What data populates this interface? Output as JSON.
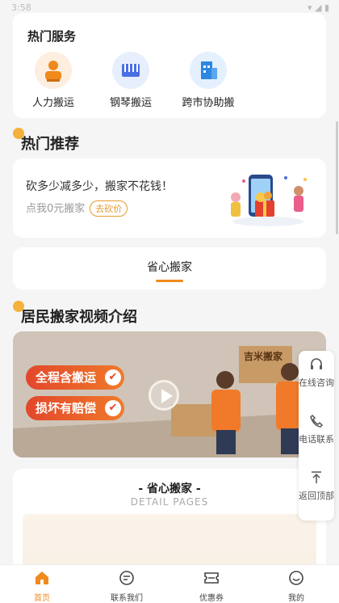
{
  "statusbar": {
    "time": "3:58",
    "icons": "▾ ◢ ▮"
  },
  "services": {
    "title": "热门服务",
    "items": [
      {
        "label": "人力搬运",
        "icon": "mover-person-icon",
        "bg": "#fdeee0",
        "color": "#f08a1c"
      },
      {
        "label": "钢琴搬运",
        "icon": "piano-icon",
        "bg": "#e7eefc",
        "color": "#4a6fe3"
      },
      {
        "label": "跨市协助搬",
        "icon": "building-icon",
        "bg": "#e4f0fd",
        "color": "#2f86e0"
      }
    ]
  },
  "recommend": {
    "title": "热门推荐",
    "line1": "砍多少减多少，搬家不花钱！",
    "line2": "点我0元搬家",
    "tag": "去砍价"
  },
  "easy_tab": "省心搬家",
  "video_section": {
    "title": "居民搬家视频介绍",
    "badge1": "全程含搬运",
    "badge2": "损坏有赔偿",
    "box_text": "吉米搬家"
  },
  "detail": {
    "title": "- 省心搬家 -",
    "subtitle": "DETAIL PAGES"
  },
  "float_bar": {
    "consult": "在线咨询",
    "phone": "电话联系",
    "top": "返回顶部"
  },
  "tabs": [
    {
      "label": "首页",
      "icon": "home-icon",
      "active": true
    },
    {
      "label": "联系我们",
      "icon": "chat-icon",
      "active": false
    },
    {
      "label": "优惠券",
      "icon": "coupon-icon",
      "active": false
    },
    {
      "label": "我的",
      "icon": "profile-icon",
      "active": false
    }
  ],
  "colors": {
    "accent": "#f08a1c",
    "dot": "#f4b23c",
    "badge": "#e2472b"
  }
}
